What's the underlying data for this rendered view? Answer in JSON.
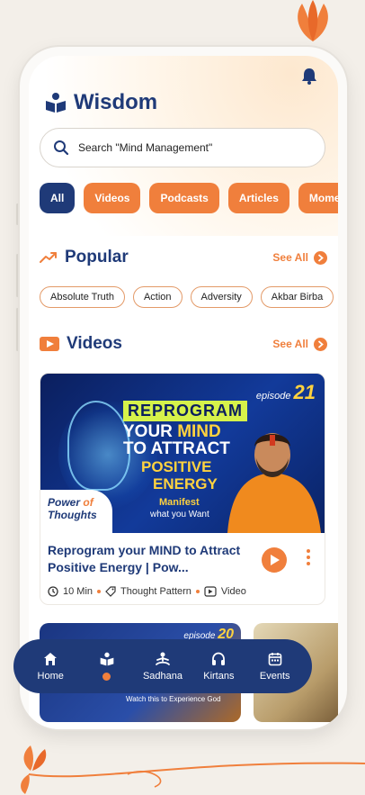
{
  "app": {
    "title": "Wisdom"
  },
  "search": {
    "placeholder": "Search \"Mind Management\""
  },
  "categories": [
    {
      "label": "All",
      "active": true
    },
    {
      "label": "Videos",
      "active": false
    },
    {
      "label": "Podcasts",
      "active": false
    },
    {
      "label": "Articles",
      "active": false
    },
    {
      "label": "Momen",
      "active": false
    }
  ],
  "popular": {
    "heading": "Popular",
    "see_all": "See All",
    "tags": [
      "Absolute Truth",
      "Action",
      "Adversity",
      "Akbar Birba"
    ]
  },
  "videos": {
    "heading": "Videos",
    "see_all": "See All",
    "featured": {
      "title": "Reprogram your MIND to Attract Positive Energy | Pow...",
      "duration": "10 Min",
      "tag": "Thought Pattern",
      "type": "Video",
      "thumbnail": {
        "episode_word": "episode",
        "episode_number": "21",
        "line1": "REPROGRAM",
        "line2_prefix": "YOUR ",
        "line2_highlight": "MIND",
        "line3": "TO ATTRACT",
        "line4": "POSITIVE",
        "line5": "ENERGY",
        "manifest": "Manifest",
        "manifest_sub": "what you Want",
        "badge_line1": "Power",
        "badge_of": "of",
        "badge_line2": "Thoughts"
      }
    },
    "second": {
      "episode_word": "episode",
      "episode_number": "20",
      "caption": "Watch this to Experience God"
    }
  },
  "bottom_nav": [
    {
      "label": "Home",
      "icon": "home-icon"
    },
    {
      "label": "",
      "icon": "wisdom-icon",
      "active_dot": true
    },
    {
      "label": "Sadhana",
      "icon": "meditation-icon"
    },
    {
      "label": "Kirtans",
      "icon": "headphones-icon"
    },
    {
      "label": "Events",
      "icon": "calendar-icon"
    }
  ],
  "colors": {
    "primary": "#1f3a78",
    "accent": "#f07f3c",
    "background": "#f3efe9"
  }
}
